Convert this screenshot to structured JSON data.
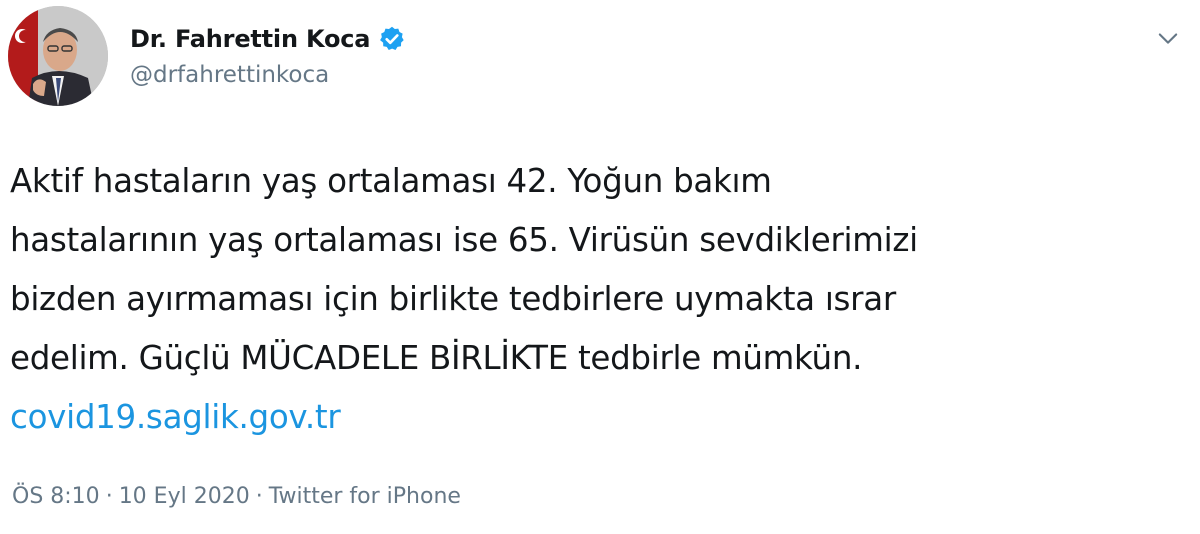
{
  "author": {
    "display_name": "Dr. Fahrettin Koca",
    "handle": "@drfahrettinkoca",
    "verified_icon": "verified-badge-icon",
    "avatar_icon": "profile-avatar"
  },
  "menu": {
    "caret_icon": "chevron-down-icon"
  },
  "tweet": {
    "lines": [
      "Aktif hastaların yaş ortalaması 42. Yoğun bakım",
      "hastalarının yaş ortalaması ise 65. Virüsün sevdiklerimizi",
      "bizden ayırmaması için birlikte tedbirlere uymakta ısrar",
      "edelim. Güçlü MÜCADELE BİRLİKTE tedbirle mümkün."
    ],
    "link": "covid19.saglik.gov.tr"
  },
  "meta": {
    "time": "ÖS 8:10",
    "separator": "·",
    "date": "10 Eyl 2020",
    "source": "Twitter for iPhone"
  },
  "colors": {
    "link": "#1b95e0",
    "verified": "#1da1f2",
    "secondary_text": "#657786",
    "primary_text": "#14171a"
  }
}
